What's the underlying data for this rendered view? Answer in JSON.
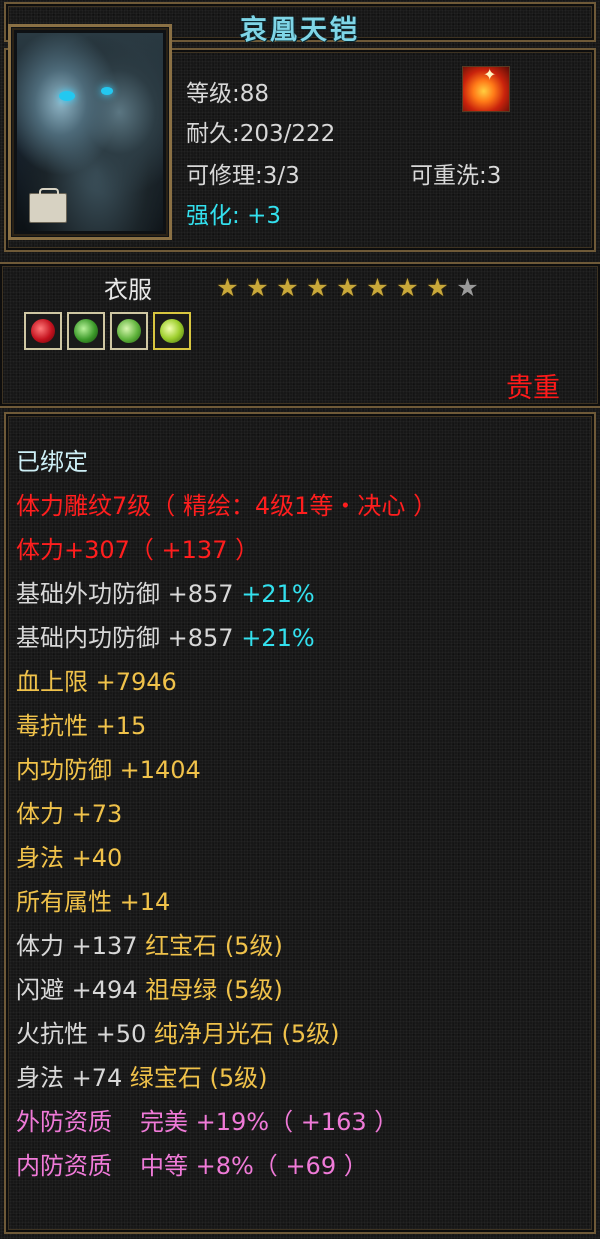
{
  "title": "哀凰天铠",
  "header": {
    "level_label": "等级",
    "level_value": "88",
    "durability_label": "耐久",
    "durability_value": "203/222",
    "repairable_label": "可修理",
    "repairable_value": "3/3",
    "rewash_label": "可重洗",
    "rewash_value": "3",
    "enhance_label": "强化",
    "enhance_value": "+3"
  },
  "item": {
    "type": "衣服",
    "stars_total": 9,
    "stars_filled": 8,
    "rarity": "贵重",
    "gem_slots": [
      "red-gem-icon",
      "green-gem-icon",
      "jade-gem-icon",
      "yellow-green-gem-icon"
    ]
  },
  "attributes": [
    {
      "text": "已绑定",
      "color": "white"
    },
    {
      "text": "体力雕纹7级（ 精绘：4级1等・决心 ）",
      "color": "red"
    },
    {
      "text": "体力+307（ +137 ）",
      "color": "red"
    },
    {
      "text": "基础外功防御 +857",
      "extra": "+21%",
      "color": "gray"
    },
    {
      "text": "基础内功防御 +857",
      "extra": "+21%",
      "color": "gray"
    },
    {
      "text": "血上限 +7946",
      "color": "gold"
    },
    {
      "text": "毒抗性 +15",
      "color": "gold"
    },
    {
      "text": "内功防御 +1404",
      "color": "gold"
    },
    {
      "text": "体力 +73",
      "color": "gold"
    },
    {
      "text": "身法 +40",
      "color": "gold"
    },
    {
      "text": "所有属性 +14",
      "color": "gold"
    },
    {
      "text": "体力 +137",
      "extra": "红宝石 (5级)",
      "color": "gray",
      "extra_color": "gold"
    },
    {
      "text": "闪避 +494",
      "extra": "祖母绿 (5级)",
      "color": "gray",
      "extra_color": "gold"
    },
    {
      "text": "火抗性 +50",
      "extra": "纯净月光石 (5级)",
      "color": "gray",
      "extra_color": "gold"
    },
    {
      "text": "身法 +74",
      "extra": "绿宝石 (5级)",
      "color": "gray",
      "extra_color": "gold"
    },
    {
      "text": "外防资质",
      "extra": "完美 +19%（ +163 ）",
      "color": "pink"
    },
    {
      "text": "内防资质",
      "extra": "中等 +8%（ +69 ）",
      "color": "pink"
    }
  ]
}
